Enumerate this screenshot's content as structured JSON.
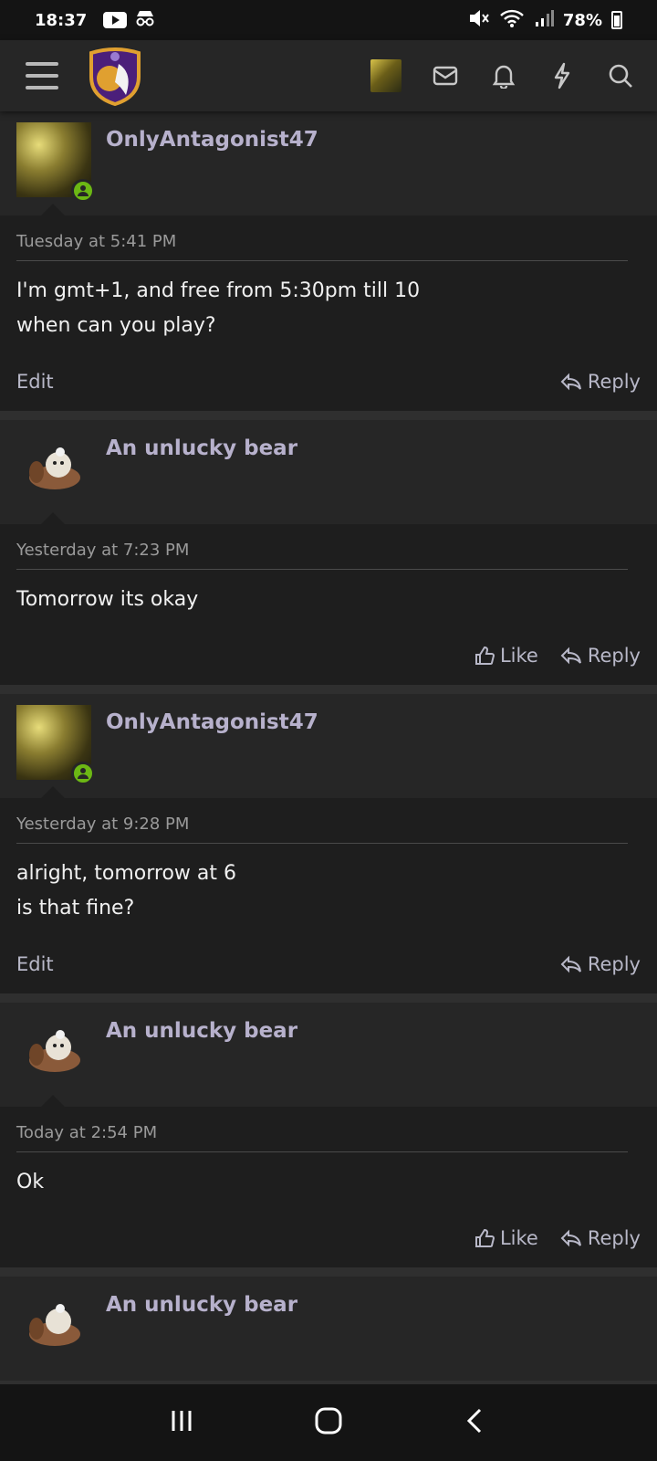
{
  "status_bar": {
    "time": "18:37",
    "battery": "78%",
    "icons": [
      "youtube-icon",
      "incognito-icon",
      "mute-icon",
      "wifi-icon",
      "signal-icon",
      "battery-icon"
    ]
  },
  "appbar": {
    "icons": [
      "menu-icon",
      "site-logo",
      "user-avatar",
      "envelope-icon",
      "bell-icon",
      "bolt-icon",
      "search-icon"
    ]
  },
  "posts": [
    {
      "username": "OnlyAntagonist47",
      "online": true,
      "date": "Tuesday at 5:41 PM",
      "text": "I'm gmt+1, and free from 5:30pm till 10\nwhen can you play?",
      "left_action": "Edit",
      "like_label": "",
      "reply_label": "Reply"
    },
    {
      "username": "An unlucky bear",
      "online": false,
      "date": "Yesterday at 7:23 PM",
      "text": "Tomorrow its okay",
      "left_action": "",
      "like_label": "Like",
      "reply_label": "Reply"
    },
    {
      "username": "OnlyAntagonist47",
      "online": true,
      "date": "Yesterday at 9:28 PM",
      "text": "alright, tomorrow at 6\nis that fine?",
      "left_action": "Edit",
      "like_label": "",
      "reply_label": "Reply"
    },
    {
      "username": "An unlucky bear",
      "online": false,
      "date": "Today at 2:54 PM",
      "text": "Ok",
      "left_action": "",
      "like_label": "Like",
      "reply_label": "Reply"
    },
    {
      "username": "An unlucky bear",
      "online": false,
      "date": "",
      "text": "",
      "left_action": "",
      "like_label": "",
      "reply_label": ""
    }
  ],
  "navbar": {
    "icons": [
      "recent-apps-icon",
      "home-icon",
      "back-icon"
    ]
  }
}
